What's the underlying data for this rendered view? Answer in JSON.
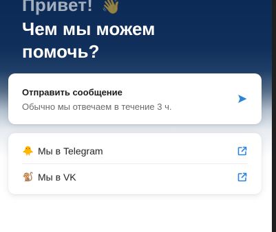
{
  "header": {
    "greeting": "Привет!",
    "greeting_emoji": "👋",
    "headline": "Чем мы можем помочь?"
  },
  "send_message": {
    "title": "Отправить сообщение",
    "subtitle": "Обычно мы отвечаем в течение 3 ч.",
    "icon": "send-arrow-icon"
  },
  "links": [
    {
      "emoji": "🐥",
      "label": "Мы в Telegram",
      "icon": "external-link-icon"
    },
    {
      "emoji": "🐒",
      "label": "Мы в VK",
      "icon": "external-link-icon"
    }
  ],
  "colors": {
    "accent": "#2b84d8",
    "hero_top": "#0c2a56"
  }
}
